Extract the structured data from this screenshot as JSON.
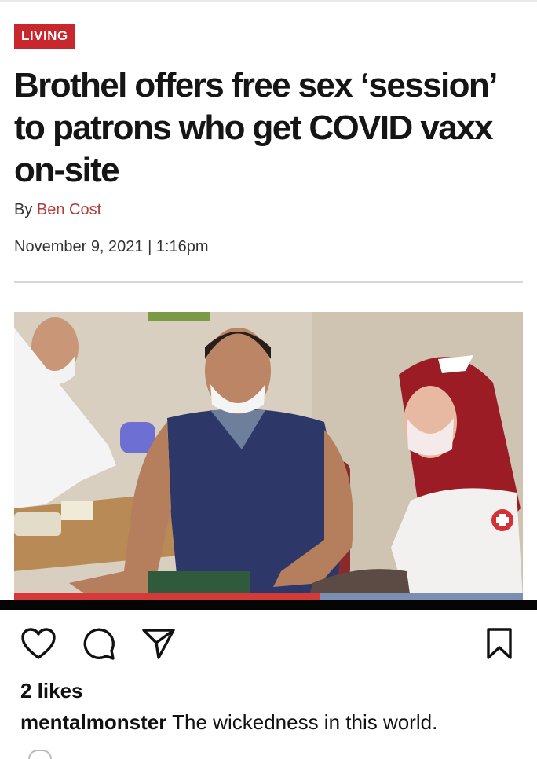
{
  "article": {
    "category": "LIVING",
    "headline": "Brothel offers free sex ‘session’ to patrons who get COVID vaxx on-site",
    "byline_prefix": "By",
    "author": "Ben Cost",
    "date": "November 9, 2021 | 1:16pm",
    "colors": {
      "category_bg": "#c8272d",
      "author": "#b23a3a"
    }
  },
  "video": {
    "progress": 0.6,
    "colors": {
      "played": "#d43a3a",
      "remaining": "#7c8fb3"
    }
  },
  "actions": {
    "icons": [
      "heart-icon",
      "comment-icon",
      "share-icon",
      "bookmark-icon"
    ]
  },
  "post": {
    "likes": "2 likes",
    "username": "mentalmonster",
    "caption": "The wickedness in this world."
  }
}
